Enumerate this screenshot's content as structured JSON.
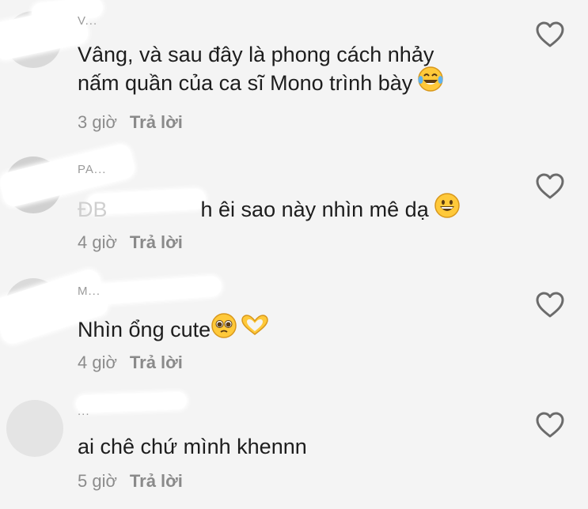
{
  "comments": [
    {
      "username": "V...",
      "text": "Vâng, và sau đây là phong cách nhảy",
      "text_line2": "nấm quần của ca sĩ Mono trình bày",
      "emoji_icon": "laughing-tears-emoji",
      "time": "3 giờ",
      "reply": "Trả lời"
    },
    {
      "username": "PA...",
      "text_prefix": "ĐB",
      "text": "h êi sao này nhìn mê dạ",
      "emoji_icon": "grinning-face-emoji",
      "time": "4 giờ",
      "reply": "Trả lời"
    },
    {
      "username": "M...",
      "text": "Nhìn ổng cute",
      "emoji_icon": "pleading-face-emoji",
      "emoji_icon_2": "heart-hands-emoji",
      "time": "4 giờ",
      "reply": "Trả lời"
    },
    {
      "username": "...",
      "text": "ai chê chứ mình khennn",
      "time": "5 giờ",
      "reply": "Trả lời"
    }
  ],
  "colors": {
    "background": "#f4f4f4",
    "text": "#1d1d1d",
    "meta": "#8c8c8c",
    "heart_outline": "#6b6b6b",
    "emoji_yellow": "#ffc93a"
  }
}
